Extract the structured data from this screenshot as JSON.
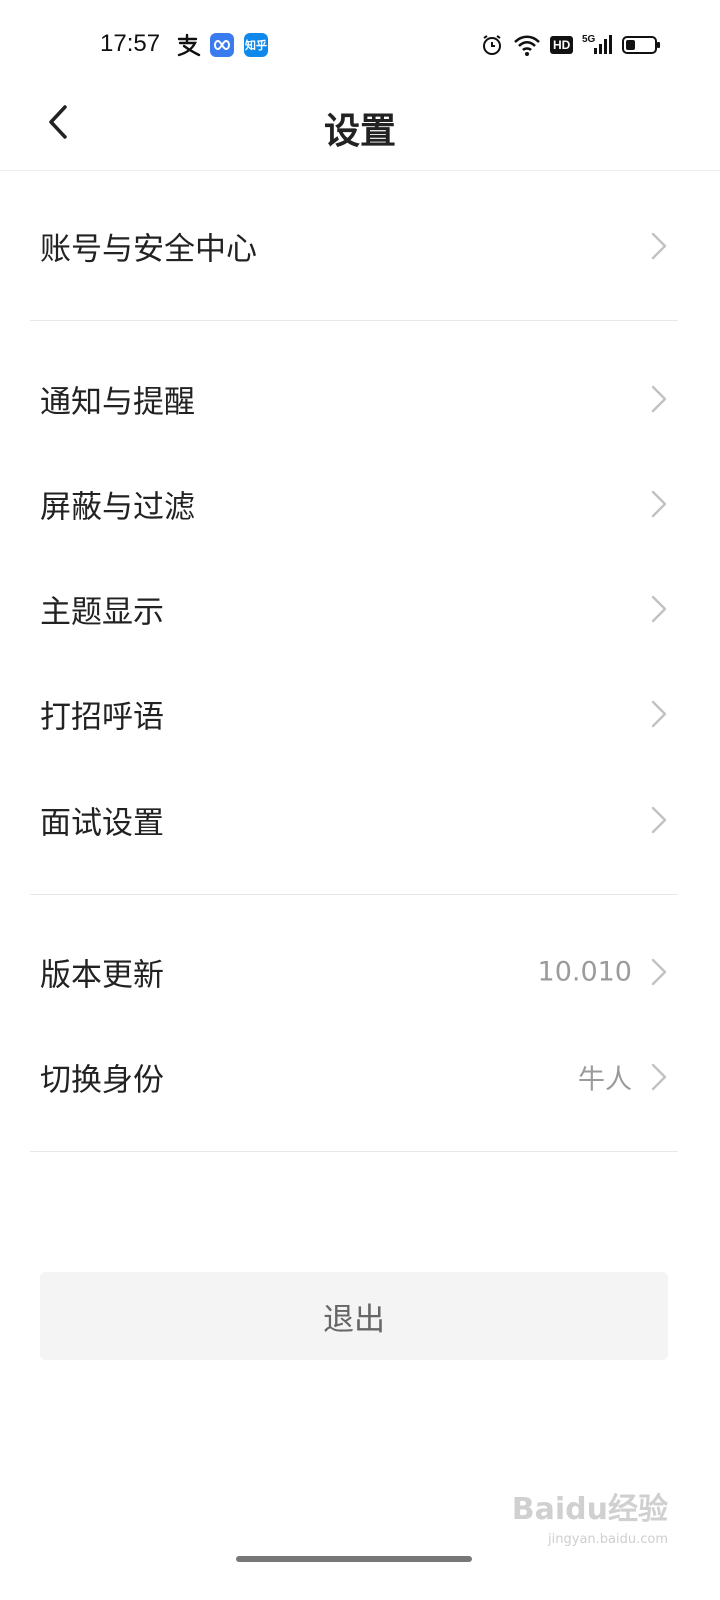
{
  "status_bar": {
    "time": "17:57",
    "app_badges": [
      "alipay-icon",
      "infinity-app-icon",
      "zhihu-app-icon"
    ],
    "zhihu_label": "知乎",
    "right_icons": [
      "alarm-icon",
      "wifi-icon",
      "hd-icon",
      "signal-5g-icon",
      "battery-icon"
    ],
    "hd_label": "HD",
    "network_label": "5G"
  },
  "header": {
    "title": "设置",
    "back_icon": "chevron-left-icon"
  },
  "settings": {
    "account": {
      "label": "账号与安全中心"
    },
    "notifications": {
      "label": "通知与提醒"
    },
    "filter": {
      "label": "屏蔽与过滤"
    },
    "theme": {
      "label": "主题显示"
    },
    "greeting": {
      "label": "打招呼语"
    },
    "interview": {
      "label": "面试设置"
    },
    "version": {
      "label": "版本更新",
      "value": "10.010"
    },
    "identity": {
      "label": "切换身份",
      "value": "牛人"
    }
  },
  "logout": {
    "label": "退出"
  },
  "watermark": {
    "main": "Baidu经验",
    "sub": "jingyan.baidu.com"
  },
  "colors": {
    "accent_blue": "#3a7bf0",
    "zhihu_blue": "#0f88eb",
    "text_primary": "#222222",
    "text_secondary": "#9b9b9b",
    "divider": "#e8e8e8",
    "button_bg": "#f4f4f4"
  }
}
